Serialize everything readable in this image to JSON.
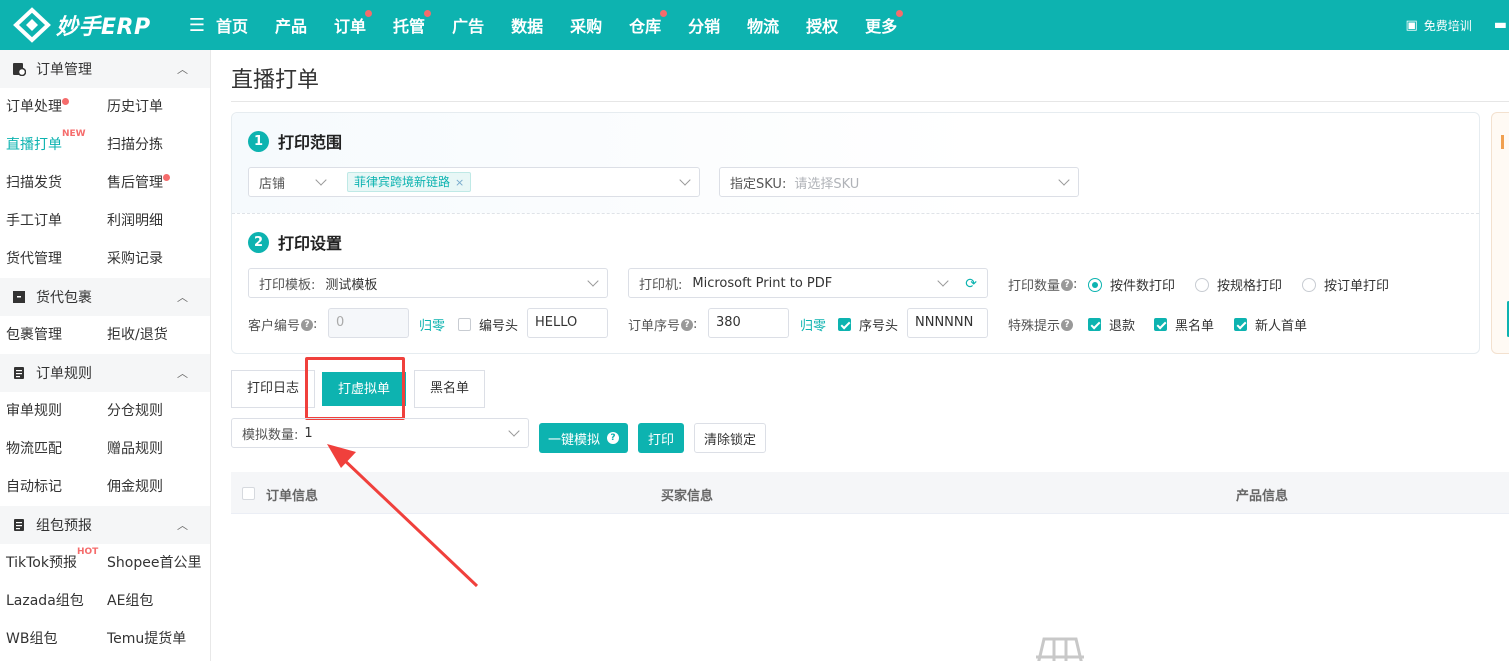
{
  "app": {
    "logo_text": "妙手ERP",
    "colors": {
      "brand": "#0db3b0",
      "highlight": "#f0403c",
      "dot": "#f56c6c"
    }
  },
  "topnav": {
    "items": [
      {
        "label": "首页",
        "dot": false
      },
      {
        "label": "产品",
        "dot": false
      },
      {
        "label": "订单",
        "dot": true
      },
      {
        "label": "托管",
        "dot": true
      },
      {
        "label": "广告",
        "dot": false
      },
      {
        "label": "数据",
        "dot": false
      },
      {
        "label": "采购",
        "dot": false
      },
      {
        "label": "仓库",
        "dot": true
      },
      {
        "label": "分销",
        "dot": false
      },
      {
        "label": "物流",
        "dot": false
      },
      {
        "label": "授权",
        "dot": false
      },
      {
        "label": "更多",
        "dot": true
      }
    ],
    "training_label": "免费培训"
  },
  "sidebar": {
    "sections": [
      {
        "title": "订单管理",
        "icon": "order-icon",
        "items": [
          {
            "label": "订单处理",
            "dot": true
          },
          {
            "label": "历史订单"
          },
          {
            "label": "直播打单",
            "active": true,
            "tag": "NEW"
          },
          {
            "label": "扫描分拣"
          },
          {
            "label": "扫描发货"
          },
          {
            "label": "售后管理",
            "dot": true
          },
          {
            "label": "手工订单"
          },
          {
            "label": "利润明细"
          },
          {
            "label": "货代管理"
          },
          {
            "label": "采购记录"
          }
        ]
      },
      {
        "title": "货代包裹",
        "icon": "package-icon",
        "items": [
          {
            "label": "包裹管理"
          },
          {
            "label": "拒收/退货"
          }
        ]
      },
      {
        "title": "订单规则",
        "icon": "rules-icon",
        "items": [
          {
            "label": "审单规则"
          },
          {
            "label": "分仓规则"
          },
          {
            "label": "物流匹配"
          },
          {
            "label": "赠品规则"
          },
          {
            "label": "自动标记"
          },
          {
            "label": "佣金规则"
          }
        ]
      },
      {
        "title": "组包预报",
        "icon": "forecast-icon",
        "items": [
          {
            "label": "TikTok预报",
            "tag": "HOT"
          },
          {
            "label": "Shopee首公里"
          },
          {
            "label": "Lazada组包"
          },
          {
            "label": "AE组包"
          },
          {
            "label": "WB组包"
          },
          {
            "label": "Temu提货单"
          }
        ]
      }
    ]
  },
  "page": {
    "title": "直播打单",
    "range": {
      "step": "1",
      "heading": "打印范围",
      "shop_label": "店铺",
      "shop_chip": "菲律宾跨境新链路",
      "sku_label": "指定SKU:",
      "sku_placeholder": "请选择SKU"
    },
    "settings": {
      "step": "2",
      "heading": "打印设置",
      "template_label": "打印模板:",
      "template_value": "测试模板",
      "printer_label": "打印机:",
      "printer_value": "Microsoft Print to PDF",
      "quantity_label": "打印数量",
      "quantity_options": [
        "按件数打印",
        "按规格打印",
        "按订单打印"
      ],
      "quantity_selected": 0,
      "customer_no_label": "客户编号",
      "customer_no_value": "0",
      "reset_label_1": "归零",
      "code_head_label": "编号头",
      "code_head_value": "HELLO",
      "order_seq_label": "订单序号",
      "order_seq_value": "380",
      "reset_label_2": "归零",
      "seq_head_label": "序号头",
      "seq_head_value": "NNNNNN",
      "special_label": "特殊提示",
      "special_options": [
        "退款",
        "黑名单",
        "新人首单"
      ]
    },
    "tabs": [
      "打印日志",
      "打虚拟单",
      "黑名单"
    ],
    "active_tab": 1,
    "toolbar": {
      "sim_label": "模拟数量:",
      "sim_value": "1",
      "one_click_label": "一键模拟",
      "print_label": "打印",
      "clear_lock_label": "清除锁定"
    },
    "table": {
      "headers": [
        "订单信息",
        "买家信息",
        "产品信息"
      ]
    }
  }
}
